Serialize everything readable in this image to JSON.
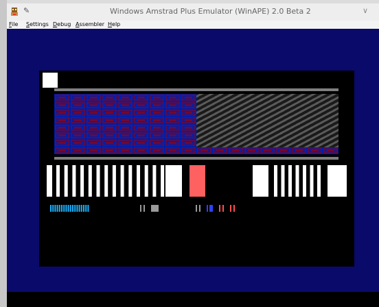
{
  "window": {
    "title": "Windows Amstrad Plus Emulator (WinAPE) 2.0 Beta 2"
  },
  "menu": {
    "items": [
      {
        "accel": "F",
        "rest": "ile"
      },
      {
        "accel": "S",
        "rest": "ettings"
      },
      {
        "accel": "D",
        "rest": "ebug"
      },
      {
        "accel": "A",
        "rest": "ssembler"
      },
      {
        "accel": "H",
        "rest": "elp"
      }
    ]
  },
  "icons": {
    "app": "winape-app-icon",
    "pin": "pin-icon",
    "chevron": "chevron-down-icon"
  },
  "colors": {
    "border": "#0a0a6a",
    "paper": "#000000",
    "grid_blue": "#001da8",
    "grid_red": "#a00000",
    "highlight_key": "#ff6060",
    "status_cyan": "#1ab2ff",
    "status_blue": "#3040ff",
    "status_red": "#ff5050",
    "status_grey": "#9a9a9a"
  }
}
